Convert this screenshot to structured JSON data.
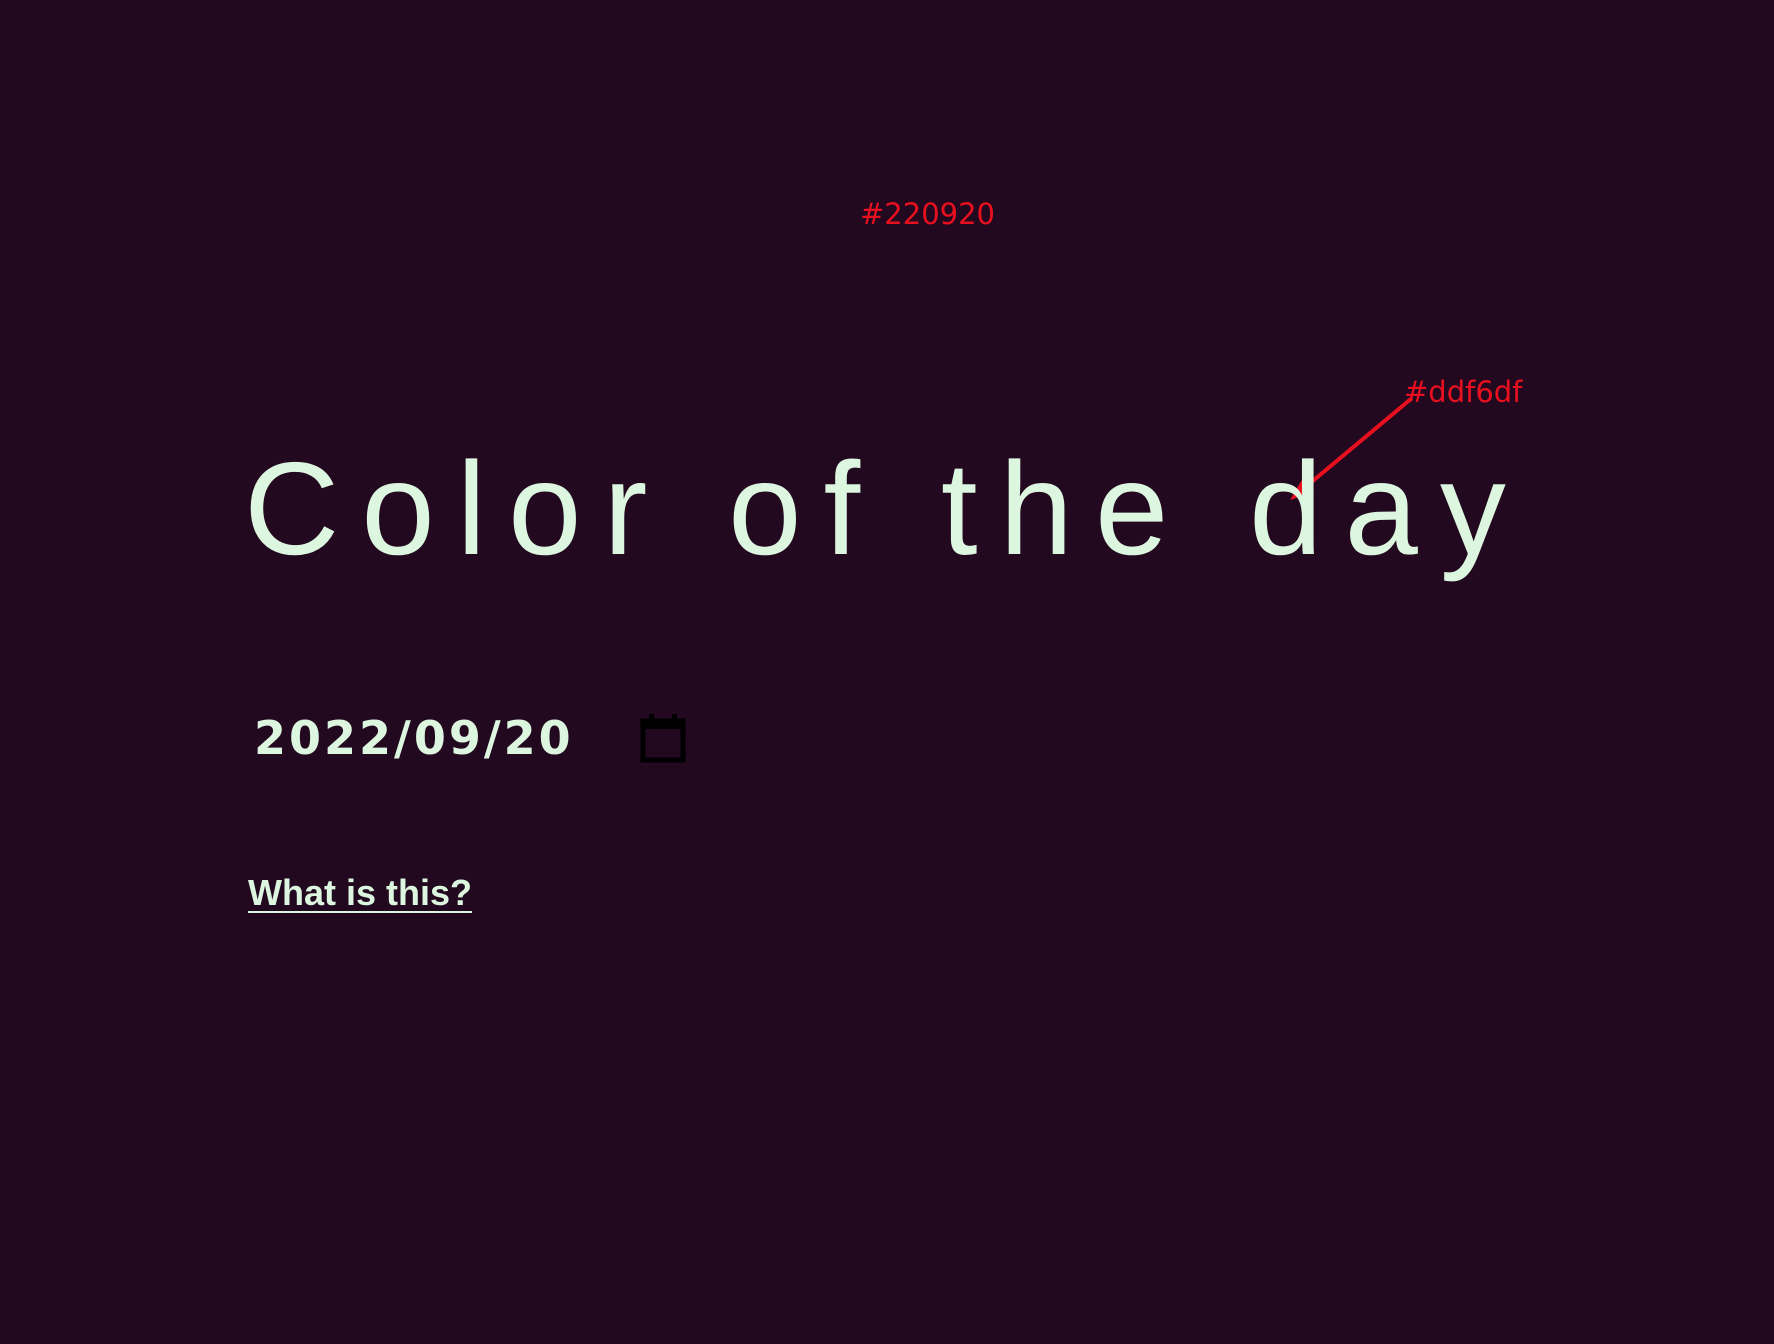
{
  "colors": {
    "background": "#220920",
    "foreground": "#ddf6df",
    "annotation": "#e8101e"
  },
  "annotations": {
    "background_hex": "#220920",
    "foreground_hex": "#ddf6df"
  },
  "header": {
    "title": "Color of the day"
  },
  "date_picker": {
    "value": "2022/09/20",
    "icon": "calendar-icon"
  },
  "help_link": {
    "label": "What is this?"
  }
}
